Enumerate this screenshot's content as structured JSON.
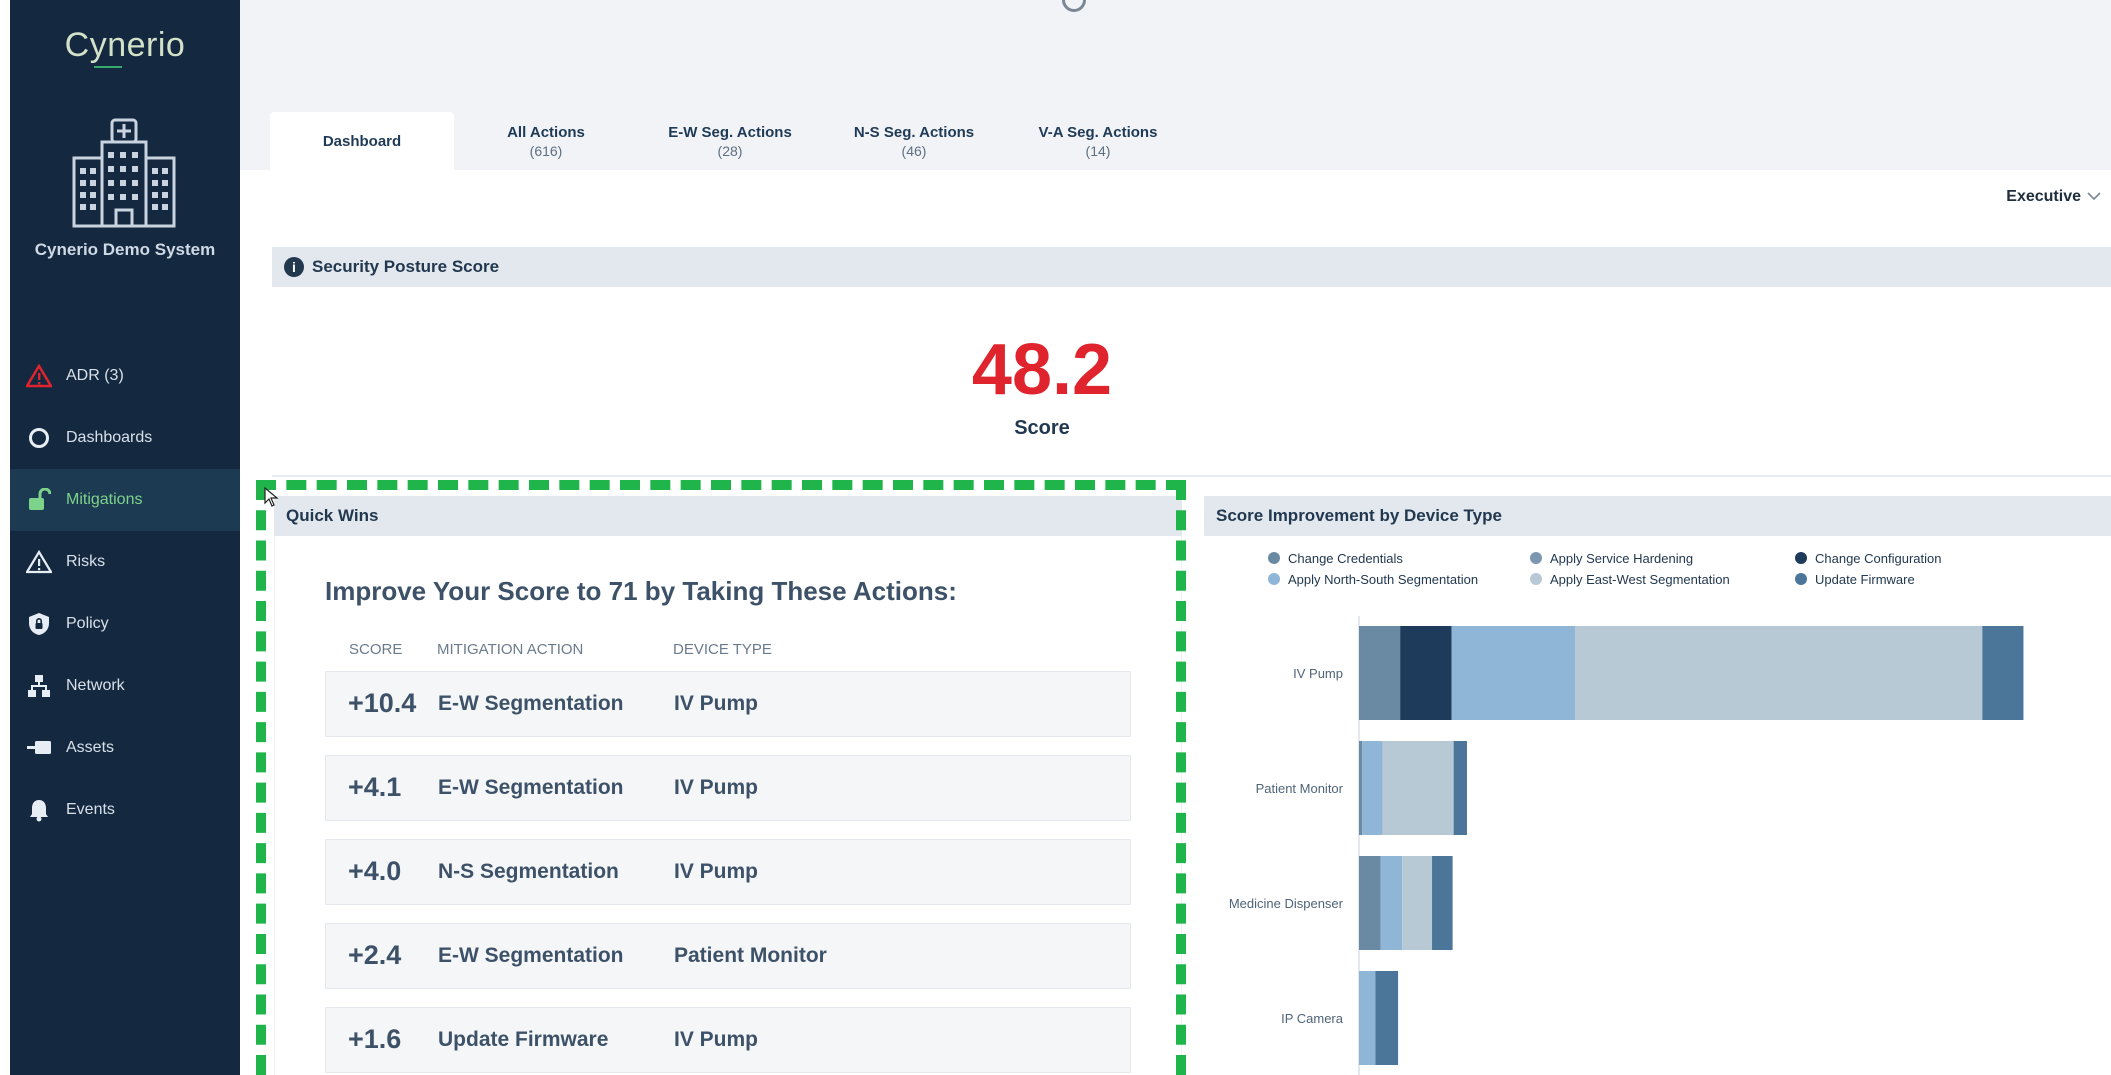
{
  "app": {
    "brand": "Cynerio",
    "org_name": "Cynerio Demo System"
  },
  "sidebar": {
    "items": [
      {
        "label": "ADR (3)",
        "icon": "warning-icon",
        "color": "#e0242d"
      },
      {
        "label": "Dashboards",
        "icon": "circle-icon"
      },
      {
        "label": "Mitigations",
        "icon": "unlock-icon",
        "active": true,
        "color": "#7ed38b"
      },
      {
        "label": "Risks",
        "icon": "warning-outline-icon"
      },
      {
        "label": "Policy",
        "icon": "shield-icon"
      },
      {
        "label": "Network",
        "icon": "network-icon"
      },
      {
        "label": "Assets",
        "icon": "device-icon"
      },
      {
        "label": "Events",
        "icon": "bell-icon"
      }
    ]
  },
  "tabs": [
    {
      "label": "Dashboard",
      "count": ""
    },
    {
      "label": "All Actions",
      "count": "(616)"
    },
    {
      "label": "E-W Seg. Actions",
      "count": "(28)"
    },
    {
      "label": "N-S Seg. Actions",
      "count": "(46)"
    },
    {
      "label": "V-A Seg. Actions",
      "count": "(14)"
    }
  ],
  "view_select": {
    "label": "Executive"
  },
  "security_posture": {
    "title": "Security Posture Score",
    "score": "48.2",
    "score_label": "Score",
    "score_color": "#e0242d"
  },
  "quick_wins": {
    "title": "Quick Wins",
    "heading": "Improve Your Score to 71 by Taking These Actions:",
    "columns": {
      "score": "SCORE",
      "action": "MITIGATION ACTION",
      "device": "DEVICE TYPE"
    },
    "rows": [
      {
        "score": "+10.4",
        "action": "E-W Segmentation",
        "device": "IV Pump"
      },
      {
        "score": "+4.1",
        "action": "E-W Segmentation",
        "device": "IV Pump"
      },
      {
        "score": "+4.0",
        "action": "N-S Segmentation",
        "device": "IV Pump"
      },
      {
        "score": "+2.4",
        "action": "E-W Segmentation",
        "device": "Patient Monitor"
      },
      {
        "score": "+1.6",
        "action": "Update Firmware",
        "device": "IV Pump"
      }
    ]
  },
  "score_improvement": {
    "title": "Score Improvement by Device Type",
    "chart_data": {
      "type": "bar",
      "orientation": "horizontal",
      "stacked": true,
      "categories": [
        "IV Pump",
        "Patient Monitor",
        "Medicine Dispenser",
        "IP Camera"
      ],
      "legend_position": "top",
      "series": [
        {
          "name": "Change Credentials",
          "color": "#6a8aa3",
          "values": [
            4.0,
            0.3,
            2.1,
            0
          ]
        },
        {
          "name": "Change Configuration",
          "color": "#1e3b5c",
          "values": [
            5.0,
            0,
            0,
            0
          ]
        },
        {
          "name": "Apply North-South Segmentation",
          "color": "#8fb6d6",
          "values": [
            12.0,
            2.0,
            2.1,
            1.6
          ]
        },
        {
          "name": "Apply East-West Segmentation",
          "color": "#b8c9d6",
          "values": [
            39.6,
            6.9,
            2.9,
            0
          ]
        },
        {
          "name": "Apply Service Hardening",
          "color": "#7c97b0",
          "values": [
            0,
            0,
            0,
            0
          ]
        },
        {
          "name": "Update Firmware",
          "color": "#4b7699",
          "values": [
            4.0,
            1.3,
            2.0,
            2.2
          ]
        }
      ],
      "xlim": [
        0,
        70
      ]
    }
  }
}
